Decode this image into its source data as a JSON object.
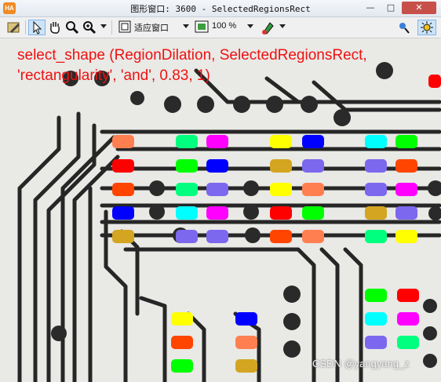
{
  "window": {
    "app_icon_text": "HA",
    "title": "图形窗口: 3600 - SelectedRegionsRect",
    "min_glyph": "—",
    "max_glyph": "□",
    "close_glyph": "✕"
  },
  "toolbar": {
    "fit_window_label": "适应窗口",
    "zoom_label": "100 %",
    "icons": [
      "save-icon",
      "pointer-icon",
      "hand-icon",
      "magnifier-icon",
      "zoom-dropdown-icon",
      "fit-window-icon",
      "zoom-icon",
      "paint-icon",
      "pixel-info-icon",
      "settings-icon"
    ]
  },
  "overlay": {
    "line1": "select_shape (RegionDilation, SelectedRegionsRect,",
    "line2": "'rectangularity', 'and', 0.83, 1)",
    "color": "#ee1111"
  },
  "watermark": "CSDN @yangyang_z",
  "pads": [
    {
      "c": "#ff7f50"
    },
    {
      "c": "#00ff7f"
    },
    {
      "c": "#ff00ff"
    },
    {
      "c": "#ffff00"
    },
    {
      "c": "#0000ff"
    },
    {
      "c": "#00ffff"
    },
    {
      "c": "#00ff00"
    },
    {
      "c": "#ff0000"
    },
    {
      "c": "#00ff00"
    },
    {
      "c": "#0000ff"
    },
    {
      "c": "#d4a520"
    },
    {
      "c": "#7b68ee"
    },
    {
      "c": "#7b68ee"
    },
    {
      "c": "#ff4500"
    },
    {
      "c": "#ff4500"
    },
    {
      "c": "#00ff7f"
    },
    {
      "c": "#7b68ee"
    },
    {
      "c": "#ffff00"
    },
    {
      "c": "#ff7f50"
    },
    {
      "c": "#7b68ee"
    },
    {
      "c": "#ff00ff"
    },
    {
      "c": "#0000ff"
    },
    {
      "c": "#00ffff"
    },
    {
      "c": "#ff00ff"
    },
    {
      "c": "#ff0000"
    },
    {
      "c": "#00ff00"
    },
    {
      "c": "#d4a520"
    },
    {
      "c": "#7b68ee"
    },
    {
      "c": "#d4a520"
    },
    {
      "c": "#7b68ee"
    },
    {
      "c": "#7b68ee"
    },
    {
      "c": "#ff4500"
    },
    {
      "c": "#ff7f50"
    },
    {
      "c": "#00ff7f"
    },
    {
      "c": "#ffff00"
    },
    {
      "c": "#00ff00"
    },
    {
      "c": "#ff0000"
    },
    {
      "c": "#00ffff"
    },
    {
      "c": "#ff00ff"
    },
    {
      "c": "#7b68ee"
    },
    {
      "c": "#00ff7f"
    },
    {
      "c": "#ffff00"
    },
    {
      "c": "#0000ff"
    },
    {
      "c": "#ff4500"
    },
    {
      "c": "#ff7f50"
    },
    {
      "c": "#00ff00"
    },
    {
      "c": "#d4a520"
    },
    {
      "c": "#ff0000"
    }
  ]
}
